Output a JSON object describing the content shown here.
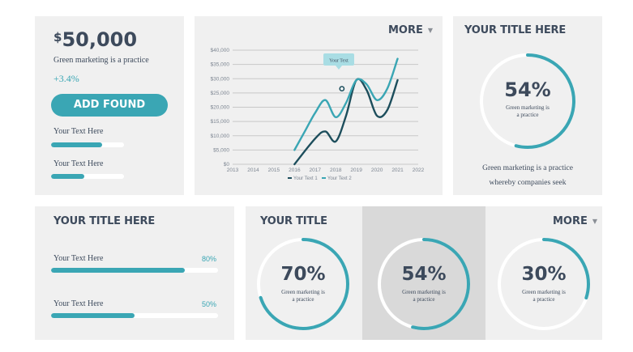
{
  "stat": {
    "currency": "$",
    "amount": "50,000",
    "subtitle": "Green marketing is a practice",
    "change": "+3.4%",
    "button_label": "ADD FOUND",
    "bars": [
      {
        "label": "Your Text Here",
        "value": 0.7
      },
      {
        "label": "Your Text Here",
        "value": 0.45
      }
    ]
  },
  "chart_card": {
    "more_label": "MORE",
    "caret": "▼"
  },
  "chart_data": {
    "type": "line",
    "x_ticks": [
      "2013",
      "2014",
      "2015",
      "2016",
      "2017",
      "2018",
      "2019",
      "2020",
      "2021",
      "2022"
    ],
    "y_ticks": [
      "$0",
      "$5,000",
      "$10,000",
      "$15,000",
      "$20,000",
      "$25,000",
      "$30,000",
      "$35,000",
      "$40,000"
    ],
    "ylim": [
      0,
      40000
    ],
    "xlim": [
      2013,
      2022
    ],
    "grid": true,
    "legend_position": "bottom",
    "annotation": "Your Text",
    "series": [
      {
        "name": "Your Text 1",
        "color": "#1d4e5c",
        "points": [
          [
            2016,
            0
          ],
          [
            2017,
            9000
          ],
          [
            2017.5,
            11500
          ],
          [
            2018,
            8000
          ],
          [
            2018.5,
            17000
          ],
          [
            2019,
            29500
          ],
          [
            2019.5,
            26000
          ],
          [
            2020,
            17000
          ],
          [
            2020.5,
            19000
          ],
          [
            2021,
            29500
          ]
        ]
      },
      {
        "name": "Your Text 2",
        "color": "#3aa6b4",
        "points": [
          [
            2016,
            5000
          ],
          [
            2016.5,
            11500
          ],
          [
            2017,
            18000
          ],
          [
            2017.5,
            22500
          ],
          [
            2018,
            16500
          ],
          [
            2018.5,
            21500
          ],
          [
            2019,
            29500
          ],
          [
            2019.5,
            28000
          ],
          [
            2020,
            22500
          ],
          [
            2020.5,
            26500
          ],
          [
            2021,
            37000
          ]
        ]
      }
    ]
  },
  "gauge_top": {
    "title": "YOUR TITLE HERE",
    "value": "54%",
    "fraction": 0.54,
    "subtitle_line1": "Green marketing is",
    "subtitle_line2": "a practice",
    "caption_line1": "Green marketing is a practice",
    "caption_line2": "whereby companies seek"
  },
  "progress_card": {
    "title": "YOUR TITLE HERE",
    "items": [
      {
        "label": "Your Text Here",
        "percent": "80%",
        "value": 0.8
      },
      {
        "label": "Your Text Here",
        "percent": "50%",
        "value": 0.5
      }
    ]
  },
  "gauges_card": {
    "title": "YOUR TITLE",
    "more_label": "MORE",
    "caret": "▼",
    "gauges": [
      {
        "value": "70%",
        "fraction": 0.7,
        "subtitle_line1": "Green marketing is",
        "subtitle_line2": "a practice"
      },
      {
        "value": "54%",
        "fraction": 0.54,
        "subtitle_line1": "Green marketing is",
        "subtitle_line2": "a practice"
      },
      {
        "value": "30%",
        "fraction": 0.3,
        "subtitle_line1": "Green marketing is",
        "subtitle_line2": "a practice"
      }
    ]
  },
  "colors": {
    "accent": "#3aa6b4",
    "dark_series": "#1d4e5c",
    "text": "#3d4a5c",
    "card": "#f0f0f0",
    "highlight_panel": "#d9d9d9"
  }
}
